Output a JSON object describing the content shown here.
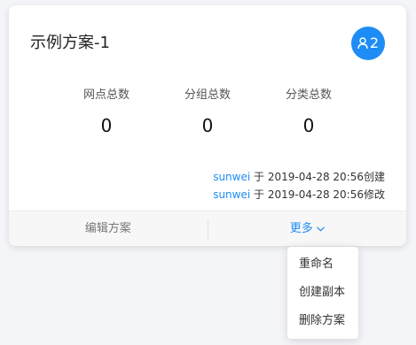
{
  "card": {
    "title": "示例方案-1",
    "member_count": "2",
    "stats": [
      {
        "label": "网点总数",
        "value": "0"
      },
      {
        "label": "分组总数",
        "value": "0"
      },
      {
        "label": "分类总数",
        "value": "0"
      }
    ],
    "log": {
      "created": {
        "user": "sunwei",
        "connector": "于",
        "time": "2019-04-28 20:56创建"
      },
      "modified": {
        "user": "sunwei",
        "connector": "于",
        "time": "2019-04-28 20:56修改"
      }
    },
    "footer": {
      "edit_label": "编辑方案",
      "more_label": "更多"
    }
  },
  "dropdown": {
    "items": [
      "重命名",
      "创建副本",
      "删除方案"
    ]
  },
  "colors": {
    "accent": "#1e8cf5",
    "background": "#f4f5f9",
    "card": "#ffffff",
    "footer": "#f7f7f7"
  },
  "icons": {
    "member": "user-icon",
    "more": "chevron-down-icon"
  }
}
